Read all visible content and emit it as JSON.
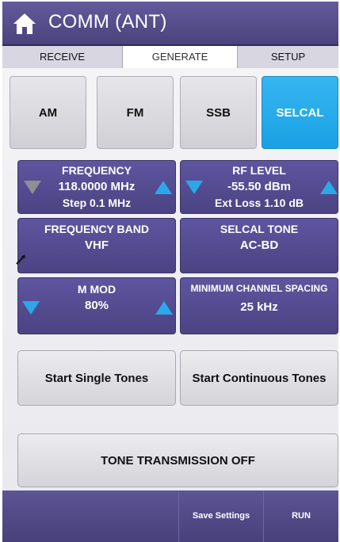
{
  "header": {
    "title": "COMM (ANT)"
  },
  "tabs": [
    {
      "label": "RECEIVE"
    },
    {
      "label": "GENERATE"
    },
    {
      "label": "SETUP"
    }
  ],
  "modes": {
    "am": "AM",
    "fm": "FM",
    "ssb": "SSB",
    "selcal": "SELCAL"
  },
  "frequency": {
    "label": "FREQUENCY",
    "value": "118.0000 MHz",
    "step": "Step 0.1 MHz"
  },
  "rf_level": {
    "label": "RF LEVEL",
    "value": "-55.50 dBm",
    "ext_loss": "Ext Loss 1.10 dB"
  },
  "frequency_band": {
    "label": "FREQUENCY BAND",
    "value": "VHF"
  },
  "selcal_tone": {
    "label": "SELCAL TONE",
    "value": "AC-BD"
  },
  "m_mod": {
    "label": "M MOD",
    "value": "80%"
  },
  "min_channel_spacing": {
    "label": "MINIMUM CHANNEL SPACING",
    "value": "25 kHz"
  },
  "buttons": {
    "start_single": "Start Single Tones",
    "start_continuous": "Start Continuous Tones",
    "tone_transmission": "TONE TRANSMISSION OFF"
  },
  "footer": {
    "save_settings": "Save Settings",
    "run": "RUN"
  },
  "colors": {
    "header": "#524a88",
    "accent": "#1fa6e8",
    "panel": "#564e94"
  }
}
